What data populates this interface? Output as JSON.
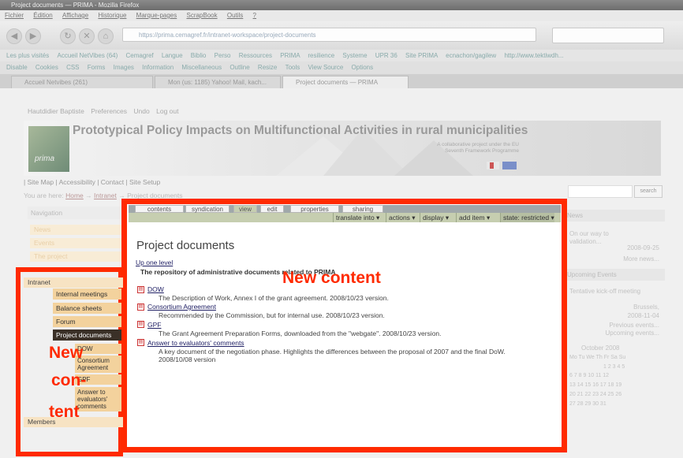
{
  "browser": {
    "title": "Project documents — PRIMA - Mozilla Firefox",
    "menu": [
      "Fichier",
      "Édition",
      "Affichage",
      "Historique",
      "Marque-pages",
      "ScrapBook",
      "Outils",
      "?"
    ],
    "url": "https://prima.cemagref.fr/intranet-workspace/project-documents",
    "bookmarks": [
      "Les plus visités",
      "Accueil NetVibes (64)",
      "Cemagref",
      "Langue",
      "Biblio",
      "Perso",
      "Ressources",
      "PRIMA",
      "resilience",
      "Systeme",
      "UPR 36",
      "Site PRIMA",
      "ecnachon/gagilew",
      "http://www.tektiwdh..."
    ],
    "devtools": [
      "Disable",
      "Cookies",
      "CSS",
      "Forms",
      "Images",
      "Information",
      "Miscellaneous",
      "Outline",
      "Resize",
      "Tools",
      "View Source",
      "Options"
    ],
    "tabs": [
      {
        "label": "Accueil Netvibes (261)"
      },
      {
        "label": "Mon (us: 1185) Yahoo! Mail, kach..."
      },
      {
        "label": "Project documents — PRIMA"
      }
    ]
  },
  "site": {
    "userbar": [
      "Hautdidier Baptiste",
      "Preferences",
      "Undo",
      "Log out"
    ],
    "title": "Prototypical Policy Impacts on Multifunctional Activities in rural municipalities",
    "tagline": "A collaborative project under the EU Seventh Framework Programme",
    "logo_text": "prima",
    "sitelinks": "| Site Map | Accessibility | Contact | Site Setup",
    "breadcrumb": {
      "prefix": "You are here:",
      "home": "Home",
      "sep1": "→",
      "intranet": "Intranet",
      "sep2": "→",
      "current": "Project documents"
    },
    "search_button": "search"
  },
  "content_tabs": [
    "contents",
    "syndication",
    "view",
    "edit",
    "properties",
    "sharing"
  ],
  "actions": {
    "translate": "translate into ▾",
    "actions": "actions ▾",
    "display": "display ▾",
    "add_item": "add item ▾",
    "state": "state: restricted ▾"
  },
  "main": {
    "title": "Project documents",
    "up_one_level": "Up one level",
    "description": "The repository of administrative documents related to PRIMA",
    "documents": [
      {
        "title": "DOW",
        "description": "The Description of Work, Annex I of the grant agreement. 2008/10/23 version."
      },
      {
        "title": "Consortium Agreement",
        "description": "Recommended by the Commission, but for internal use. 2008/10/23 version."
      },
      {
        "title": "GPF",
        "description": "The Grant Agreement Preparation Forms, downloaded from the \"webgate\". 2008/10/23 version."
      },
      {
        "title": "Answer to evaluators' comments",
        "description": "A key document of the negotiation phase. Highlights the differences between the proposal of 2007 and the final DoW. 2008/10/08 version"
      }
    ]
  },
  "left_nav": {
    "heading": "Navigation",
    "faded": [
      "News",
      "Events",
      "The project"
    ],
    "intranet": "Intranet",
    "items": [
      "Internal meetings",
      "Balance sheets",
      "Forum",
      "Project documents"
    ],
    "subitems": [
      "DOW",
      "Consortium Agreement",
      "GPF",
      "Answer to evaluators' comments"
    ],
    "members": "Members"
  },
  "portlets": {
    "news_heading": "News",
    "news_item": "On our way to validation...",
    "news_date": "2008-09-25",
    "news_more": "More news...",
    "events_heading": "Upcoming Events",
    "event_item": "Tentative kick-off meeting",
    "event_place": "Brussels,",
    "event_date": "2008-11-04",
    "events_prev": "Previous events...",
    "events_upcoming": "Upcoming events...",
    "calendar_month": "October 2008",
    "calendar_days": "Mo Tu We Th Fr Sa Su",
    "calendar_rows": [
      "1 2 3 4 5",
      "6 7 8 9 10 11 12",
      "13 14 15 16 17 18 19",
      "20 21 22 23 24 25 26",
      "27 28 29 30 31"
    ]
  },
  "overlay": {
    "main_label": "New content",
    "left_label": [
      "New",
      "con-",
      "tent"
    ]
  },
  "colors": {
    "highlight": "#ff2a00",
    "nav_active": "#3a3027",
    "nav_item": "#f3d29d",
    "tab_active": "#c6ceb0"
  }
}
